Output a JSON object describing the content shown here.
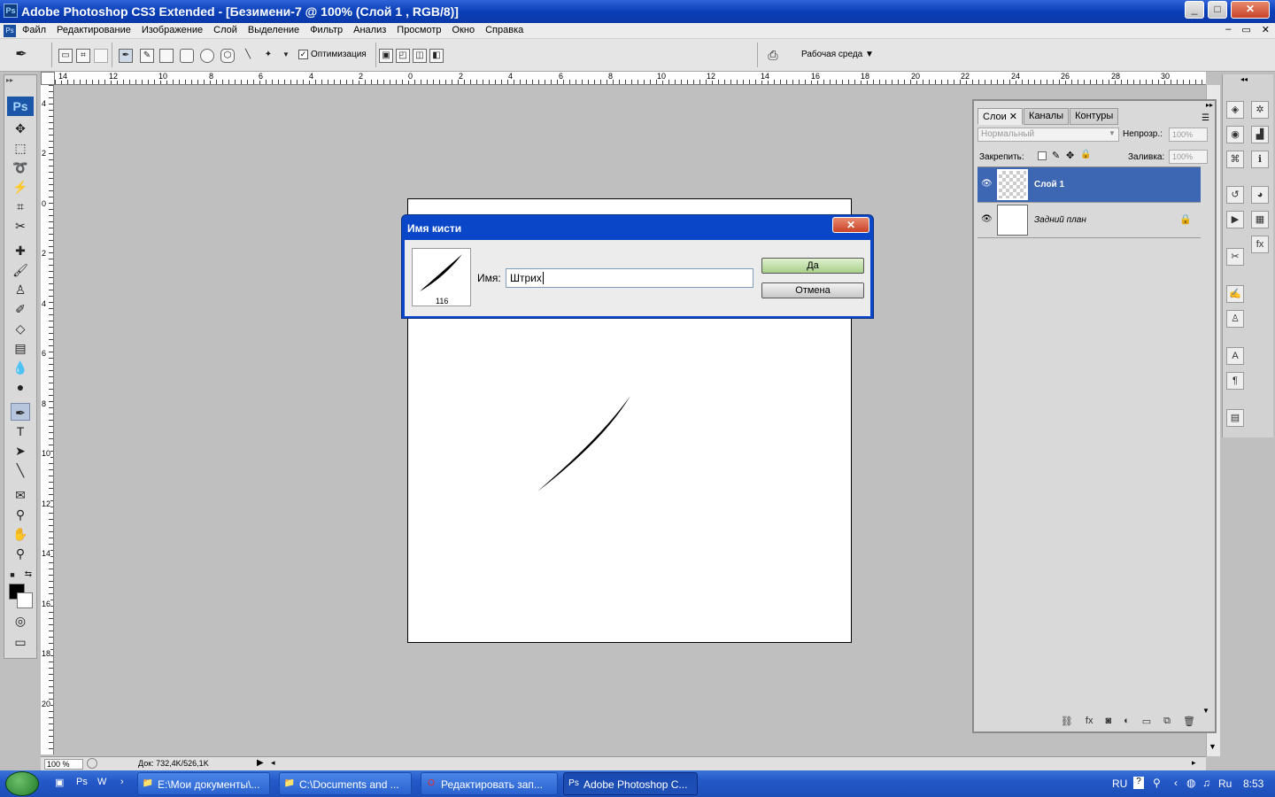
{
  "window": {
    "title": "Adobe Photoshop CS3 Extended - [Безимени-7 @ 100% (Слой 1 , RGB/8)]",
    "app_icon": "Ps",
    "buttons": [
      "_",
      "□",
      "✕"
    ]
  },
  "menu": {
    "items": [
      "Файл",
      "Редактирование",
      "Изображение",
      "Слой",
      "Выделение",
      "Фильтр",
      "Анализ",
      "Просмотр",
      "Окно",
      "Справка"
    ],
    "doc_controls": [
      "–",
      "▭",
      "✕"
    ]
  },
  "options": {
    "optimize_label": "Оптимизация",
    "workspace_label": "Рабочая среда ▼"
  },
  "toolbox": {
    "logo": "Ps"
  },
  "rulers": {
    "top": [
      "14",
      "12",
      "10",
      "8",
      "6",
      "4",
      "2",
      "0",
      "2",
      "4",
      "6",
      "8",
      "10",
      "12",
      "14",
      "16",
      "18",
      "20",
      "22",
      "24",
      "26",
      "28",
      "30"
    ],
    "left": [
      "4",
      "2",
      "0",
      "2",
      "4",
      "6",
      "8",
      "10",
      "12",
      "14",
      "16",
      "18",
      "20"
    ]
  },
  "status": {
    "zoom": "100 %",
    "doc": "Док: 732,4K/526,1K"
  },
  "layers_panel": {
    "tabs": [
      "Слои ✕",
      "Каналы",
      "Контуры"
    ],
    "blend_mode": "Нормальный",
    "opacity_label": "Непрозр.:",
    "opacity_value": "100%",
    "lock_label": "Закрепить:",
    "fill_label": "Заливка:",
    "fill_value": "100%",
    "layers": [
      {
        "name": "Слой 1",
        "selected": true
      },
      {
        "name": "Задний план",
        "selected": false
      }
    ],
    "bottom_icons": [
      "link-icon",
      "fx-icon",
      "mask-icon",
      "adjustment-icon",
      "folder-icon",
      "new-layer-icon",
      "trash-icon"
    ]
  },
  "dialog": {
    "title": "Имя кисти",
    "close": "✕",
    "brush_size": "116",
    "name_label": "Имя:",
    "name_value": "Штрих",
    "ok_label": "Да",
    "cancel_label": "Отмена"
  },
  "taskbar": {
    "items": [
      {
        "label": "E:\\Мои документы\\...",
        "active": false
      },
      {
        "label": "C:\\Documents and ...",
        "active": false
      },
      {
        "label": "Редактировать зап...",
        "active": false
      },
      {
        "label": "Adobe Photoshop C...",
        "active": true
      }
    ],
    "tray_lang": "RU",
    "tray_lang2": "Ru",
    "clock": "8:53"
  },
  "colors": {
    "titlebar": "#0a3fb8",
    "selected_layer": "#3e67b3",
    "taskbar": "#2458c8"
  }
}
